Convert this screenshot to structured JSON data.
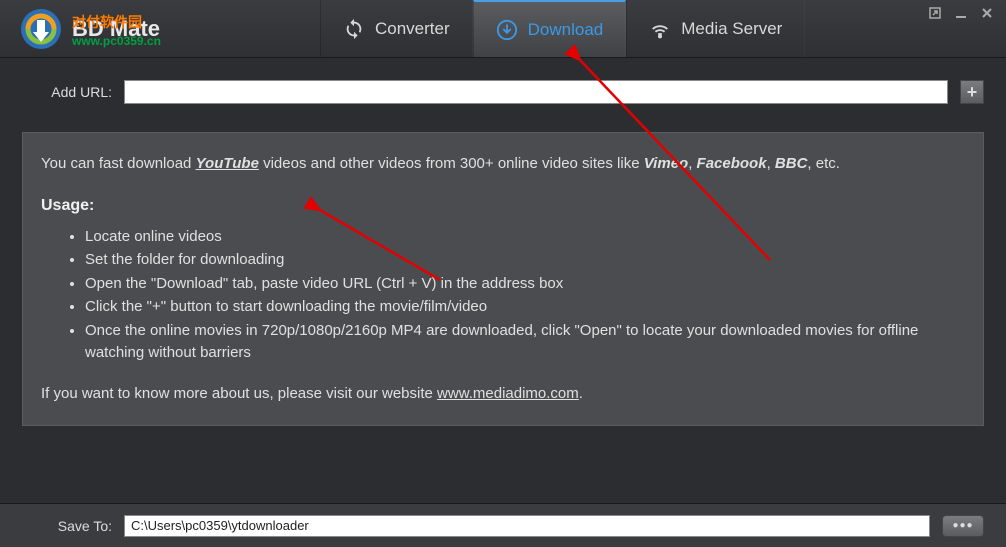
{
  "app": {
    "title": "BD Mate",
    "overlay_text": "对付软件园",
    "overlay_url": "www.pc0359.cn"
  },
  "tabs": {
    "converter": "Converter",
    "download": "Download",
    "media_server": "Media Server"
  },
  "url_row": {
    "label": "Add URL:",
    "value": ""
  },
  "info": {
    "intro_prefix": "You can fast download ",
    "intro_youtube": "YouTube",
    "intro_mid": " videos and other videos from 300+ online video sites like ",
    "intro_vimeo": "Vimeo",
    "intro_sep1": ", ",
    "intro_facebook": "Facebook",
    "intro_sep2": ", ",
    "intro_bbc": "BBC",
    "intro_suffix": ", etc.",
    "usage_title": "Usage:",
    "usage_items": [
      "Locate online videos",
      "Set the folder for downloading",
      "Open the \"Download\" tab, paste video URL (Ctrl + V) in the address box",
      "Click the \"+\" button to start downloading the movie/film/video",
      "Once the online movies in 720p/1080p/2160p MP4 are downloaded, click \"Open\" to locate your downloaded movies for offline watching without barriers"
    ],
    "footer_prefix": "If you want to know more about us, please visit our website ",
    "footer_link": "www.mediadimo.com",
    "footer_suffix": "."
  },
  "save_row": {
    "label": "Save To:",
    "value": "C:\\Users\\pc0359\\ytdownloader"
  }
}
